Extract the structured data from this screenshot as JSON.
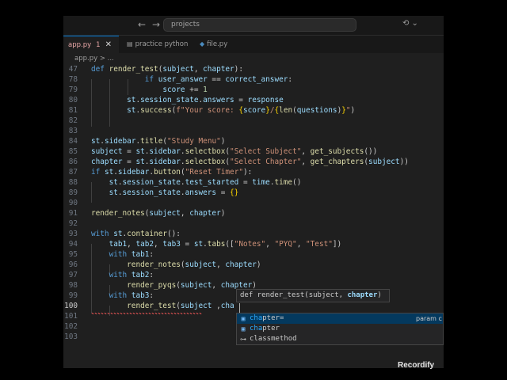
{
  "titlebar": {
    "back": "←",
    "forward": "→",
    "search_text": "projects"
  },
  "tabs": [
    {
      "name": "app.py",
      "badge": "1",
      "close": "✕",
      "active": true
    },
    {
      "name": "practice python",
      "active": false
    },
    {
      "name": "file.py",
      "active": false
    }
  ],
  "breadcrumb": "app.py > ...",
  "signature_help": {
    "prefix": "def render_test(subject, ",
    "active_param": "chapter",
    "suffix": ")"
  },
  "suggestions": [
    {
      "match": "cha",
      "rest": "pter=",
      "detail": "param c",
      "selected": true
    },
    {
      "match": "cha",
      "rest": "pter",
      "detail": "",
      "selected": false
    },
    {
      "match": "",
      "rest": "classmethod",
      "detail": "",
      "selected": false
    }
  ],
  "watermark": "Recordify",
  "colors": {
    "accent": "#0078d4",
    "error": "#e05252",
    "editor_bg": "#1f1f1f"
  }
}
